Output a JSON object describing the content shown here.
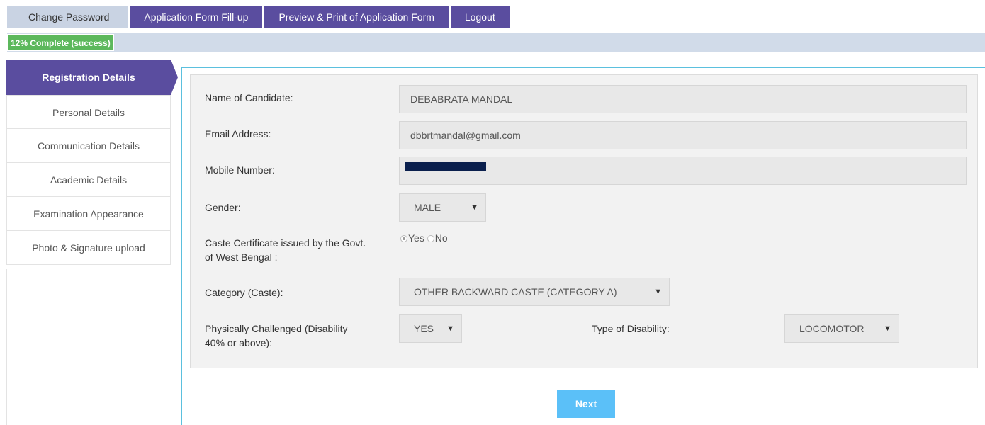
{
  "topnav": {
    "change_password": "Change Password",
    "form_fillup": "Application Form Fill-up",
    "preview_print": "Preview & Print of Application Form",
    "logout": "Logout"
  },
  "progress": {
    "label": "12% Complete (success)",
    "percent": 12
  },
  "sidebar": {
    "items": [
      {
        "label": "Registration Details",
        "active": true
      },
      {
        "label": "Personal Details"
      },
      {
        "label": "Communication Details"
      },
      {
        "label": "Academic Details"
      },
      {
        "label": "Examination Appearance"
      },
      {
        "label": "Photo & Signature upload"
      }
    ]
  },
  "form": {
    "name_label": "Name of Candidate:",
    "name_value": "DEBABRATA MANDAL",
    "email_label": "Email Address:",
    "email_value": "dbbrtmandal@gmail.com",
    "mobile_label": "Mobile Number:",
    "gender_label": "Gender:",
    "gender_value": "MALE",
    "caste_cert_label_line1": "Caste Certificate issued by the Govt.",
    "caste_cert_label_line2": "of West Bengal :",
    "caste_cert_yes": "Yes",
    "caste_cert_no": "No",
    "caste_cert_selected": "Yes",
    "category_label": "Category (Caste):",
    "category_value": "OTHER BACKWARD CASTE (CATEGORY A)",
    "pc_label_line1": "Physically Challenged (Disability",
    "pc_label_line2": "40% or above):",
    "pc_value": "YES",
    "disability_type_label": "Type of Disability:",
    "disability_type_value": "LOCOMOTOR",
    "dropdown_arrow": "▼"
  },
  "buttons": {
    "next": "Next"
  },
  "colors": {
    "nav_active": "#5a4d9f",
    "nav_inactive": "#c9d3e3",
    "progress_fill": "#5cb85c",
    "next_button": "#5bc0f8",
    "content_border": "#5bc0de"
  }
}
